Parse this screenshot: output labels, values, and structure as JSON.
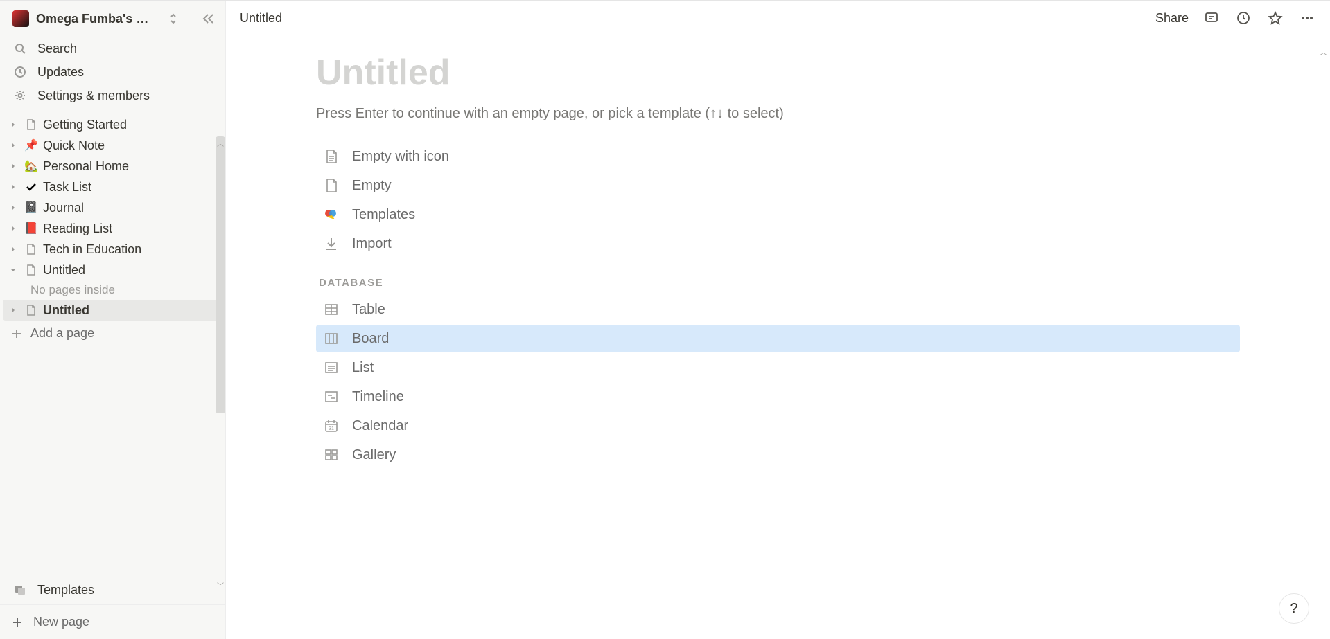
{
  "workspace": {
    "name": "Omega Fumba's …"
  },
  "sidebar": {
    "search": "Search",
    "updates": "Updates",
    "settings": "Settings & members",
    "pages": [
      {
        "icon": "📄",
        "label": "Getting Started",
        "expanded": false
      },
      {
        "icon": "📌",
        "label": "Quick Note",
        "expanded": false
      },
      {
        "icon": "🏡",
        "label": "Personal Home",
        "expanded": false
      },
      {
        "icon": "✔",
        "label": "Task List",
        "expanded": false
      },
      {
        "icon": "📓",
        "label": "Journal",
        "expanded": false
      },
      {
        "icon": "📕",
        "label": "Reading List",
        "expanded": false
      },
      {
        "icon": "📄",
        "label": "Tech in Education",
        "expanded": false
      },
      {
        "icon": "📄",
        "label": "Untitled",
        "expanded": true,
        "empty_text": "No pages inside"
      },
      {
        "icon": "📄",
        "label": "Untitled",
        "expanded": false,
        "active": true
      }
    ],
    "add_page": "Add a page",
    "templates": "Templates",
    "new_page": "New page"
  },
  "topbar": {
    "breadcrumb": "Untitled",
    "share": "Share"
  },
  "content": {
    "title_placeholder": "Untitled",
    "hint": "Press Enter to continue with an empty page, or pick a template (↑↓ to select)",
    "basic_templates": [
      {
        "label": "Empty with icon",
        "icon": "page-lines"
      },
      {
        "label": "Empty",
        "icon": "page-blank"
      },
      {
        "label": "Templates",
        "icon": "templates-color"
      },
      {
        "label": "Import",
        "icon": "import"
      }
    ],
    "db_heading": "DATABASE",
    "db_templates": [
      {
        "label": "Table",
        "icon": "table"
      },
      {
        "label": "Board",
        "icon": "board",
        "highlight": true
      },
      {
        "label": "List",
        "icon": "list"
      },
      {
        "label": "Timeline",
        "icon": "timeline"
      },
      {
        "label": "Calendar",
        "icon": "calendar"
      },
      {
        "label": "Gallery",
        "icon": "gallery"
      }
    ]
  },
  "help": "?"
}
